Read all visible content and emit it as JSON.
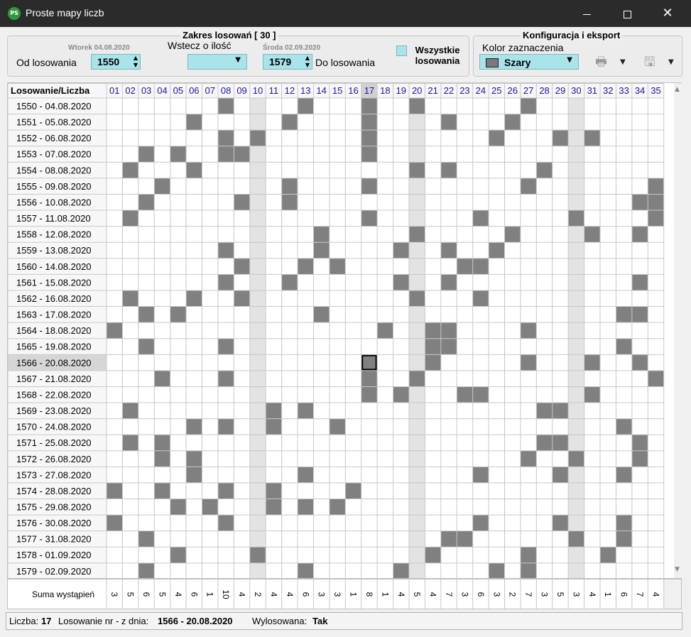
{
  "window": {
    "title": "Proste mapy liczb",
    "icon_text": "PS"
  },
  "range_group": {
    "title": "Zakres losowań  [ 30 ]",
    "from_date": "Wtorek 04.08.2020",
    "from_label": "Od losowania",
    "from_value": "1550",
    "back_label": "Wstecz o ilość",
    "back_value": "",
    "to_date": "Środa 02.09.2020",
    "to_value": "1579",
    "to_label": "Do losowania",
    "all_draws_label_1": "Wszystkie",
    "all_draws_label_2": "losowania"
  },
  "config_group": {
    "title": "Konfiguracja i eksport",
    "color_label": "Kolor zaznaczenia",
    "color_value": "Szary"
  },
  "grid": {
    "header_label": "Losowanie/Liczba",
    "columns": [
      "01",
      "02",
      "03",
      "04",
      "05",
      "06",
      "07",
      "08",
      "09",
      "10",
      "11",
      "12",
      "13",
      "14",
      "15",
      "16",
      "17",
      "18",
      "19",
      "20",
      "21",
      "22",
      "23",
      "24",
      "25",
      "26",
      "27",
      "28",
      "29",
      "30",
      "31",
      "32",
      "33",
      "34",
      "35"
    ],
    "highlighted_columns": [
      "10",
      "20",
      "30"
    ],
    "selected_column": "17",
    "selected_row": "1566 - 20.08.2020",
    "rows": [
      {
        "label": "1550 - 04.08.2020",
        "numbers": [
          8,
          13,
          17,
          20,
          27
        ]
      },
      {
        "label": "1551 - 05.08.2020",
        "numbers": [
          6,
          12,
          17,
          22,
          26
        ]
      },
      {
        "label": "1552 - 06.08.2020",
        "numbers": [
          8,
          10,
          17,
          25,
          29,
          31
        ]
      },
      {
        "label": "1553 - 07.08.2020",
        "numbers": [
          3,
          5,
          8,
          9,
          17
        ]
      },
      {
        "label": "1554 - 08.08.2020",
        "numbers": [
          2,
          6,
          20,
          22,
          28
        ]
      },
      {
        "label": "1555 - 09.08.2020",
        "numbers": [
          4,
          12,
          17,
          27,
          35
        ]
      },
      {
        "label": "1556 - 10.08.2020",
        "numbers": [
          3,
          9,
          12,
          34,
          35
        ]
      },
      {
        "label": "1557 - 11.08.2020",
        "numbers": [
          2,
          17,
          24,
          30,
          35
        ]
      },
      {
        "label": "1558 - 12.08.2020",
        "numbers": [
          14,
          20,
          26,
          31,
          34
        ]
      },
      {
        "label": "1559 - 13.08.2020",
        "numbers": [
          8,
          14,
          19,
          22,
          25
        ]
      },
      {
        "label": "1560 - 14.08.2020",
        "numbers": [
          9,
          13,
          15,
          23,
          24
        ]
      },
      {
        "label": "1561 - 15.08.2020",
        "numbers": [
          8,
          12,
          19,
          22,
          34
        ]
      },
      {
        "label": "1562 - 16.08.2020",
        "numbers": [
          2,
          6,
          9,
          20,
          24
        ]
      },
      {
        "label": "1563 - 17.08.2020",
        "numbers": [
          3,
          5,
          14,
          33,
          34
        ]
      },
      {
        "label": "1564 - 18.08.2020",
        "numbers": [
          1,
          18,
          21,
          22,
          27
        ]
      },
      {
        "label": "1565 - 19.08.2020",
        "numbers": [
          3,
          8,
          21,
          22,
          33
        ]
      },
      {
        "label": "1566 - 20.08.2020",
        "numbers": [
          17,
          21,
          27,
          31,
          34
        ]
      },
      {
        "label": "1567 - 21.08.2020",
        "numbers": [
          4,
          8,
          17,
          20,
          35
        ]
      },
      {
        "label": "1568 - 22.08.2020",
        "numbers": [
          17,
          19,
          23,
          24,
          31
        ]
      },
      {
        "label": "1569 - 23.08.2020",
        "numbers": [
          2,
          11,
          13,
          28,
          29
        ]
      },
      {
        "label": "1570 - 24.08.2020",
        "numbers": [
          6,
          8,
          11,
          15,
          33
        ]
      },
      {
        "label": "1571 - 25.08.2020",
        "numbers": [
          2,
          4,
          28,
          29,
          34
        ]
      },
      {
        "label": "1572 - 26.08.2020",
        "numbers": [
          4,
          6,
          27,
          30,
          34
        ]
      },
      {
        "label": "1573 - 27.08.2020",
        "numbers": [
          6,
          13,
          24,
          29,
          33
        ]
      },
      {
        "label": "1574 - 28.08.2020",
        "numbers": [
          1,
          4,
          8,
          11,
          16
        ]
      },
      {
        "label": "1575 - 29.08.2020",
        "numbers": [
          5,
          7,
          11,
          13,
          15
        ]
      },
      {
        "label": "1576 - 30.08.2020",
        "numbers": [
          1,
          8,
          24,
          29,
          33
        ]
      },
      {
        "label": "1577 - 31.08.2020",
        "numbers": [
          3,
          22,
          23,
          30,
          33
        ]
      },
      {
        "label": "1578 - 01.09.2020",
        "numbers": [
          5,
          10,
          21,
          27,
          32
        ]
      },
      {
        "label": "1579 - 02.09.2020",
        "numbers": [
          3,
          13,
          19,
          25,
          27
        ]
      }
    ]
  },
  "sums": {
    "label": "Suma wystąpień",
    "values": [
      "3",
      "5",
      "6",
      "5",
      "4",
      "6",
      "1",
      "10",
      "4",
      "2",
      "4",
      "4",
      "6",
      "3",
      "3",
      "1",
      "8",
      "1",
      "4",
      "5",
      "4",
      "7",
      "3",
      "6",
      "3",
      "2",
      "7",
      "3",
      "5",
      "3",
      "4",
      "1",
      "6",
      "7",
      "4"
    ]
  },
  "status": {
    "number_label": "Liczba:",
    "number_value": "17",
    "draw_label": "Losowanie nr - z dnia:",
    "draw_value": "1566 - 20.08.2020",
    "drawn_label": "Wylosowana:",
    "drawn_value": "Tak"
  },
  "colors": {
    "marked": "#808080",
    "highlight_column": "#e3e3e3",
    "accent": "#a8e4ea",
    "header_text": "#1a1aa0"
  },
  "icons": [
    "printer-icon",
    "save-icon",
    "dropdown-arrow-icon",
    "close-icon",
    "minimize-icon",
    "maximize-icon"
  ]
}
